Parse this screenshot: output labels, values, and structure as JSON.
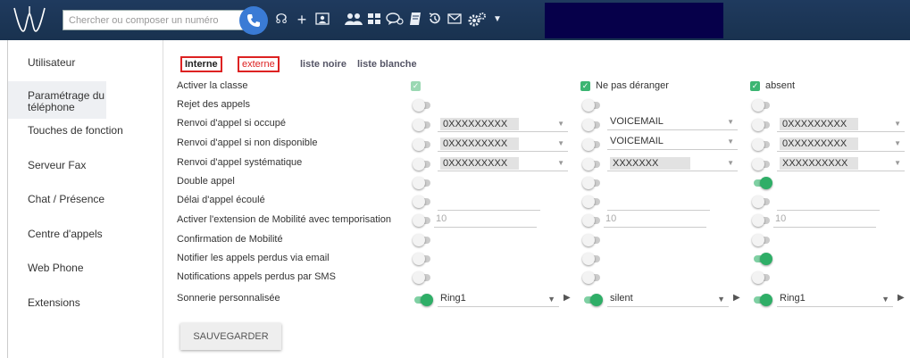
{
  "topbar": {
    "search_placeholder": "Chercher ou composer un numéro"
  },
  "sidebar": {
    "items": [
      {
        "label": "Utilisateur"
      },
      {
        "label": "Paramétrage du téléphone"
      },
      {
        "label": "Touches de fonction"
      },
      {
        "label": "Serveur Fax"
      },
      {
        "label": "Chat / Présence"
      },
      {
        "label": "Centre d'appels"
      },
      {
        "label": "Web Phone"
      },
      {
        "label": "Extensions"
      }
    ]
  },
  "tabs": {
    "interne": "Interne",
    "externe": "externe",
    "liste_noire": "liste noire",
    "liste_blanche": "liste blanche"
  },
  "columns": {
    "col1": {
      "checked": true
    },
    "col2": {
      "label": "Ne pas déranger",
      "checked": true
    },
    "col3": {
      "label": "absent",
      "checked": true
    }
  },
  "rows": [
    {
      "label": "Activer la classe"
    },
    {
      "label": "Rejet des appels"
    },
    {
      "label": "Renvoi d'appel si occupé"
    },
    {
      "label": "Renvoi d'appel si non disponible"
    },
    {
      "label": "Renvoi d'appel systématique"
    },
    {
      "label": "Double appel"
    },
    {
      "label": "Délai d'appel écoulé"
    },
    {
      "label": "Activer l'extension de Mobilité avec temporisation"
    },
    {
      "label": "Confirmation de Mobilité"
    },
    {
      "label": "Notifier les appels perdus via email"
    },
    {
      "label": "Notifications appels perdus par SMS"
    },
    {
      "label": "Sonnerie personnalisée"
    }
  ],
  "values": {
    "busy": [
      "0XXXXXXXXX",
      "VOICEMAIL",
      "0XXXXXXXXX"
    ],
    "unavailable": [
      "0XXXXXXXXX",
      "VOICEMAIL",
      "0XXXXXXXXX"
    ],
    "systematic": [
      "0XXXXXXXXX",
      "XXXXXXX",
      "XXXXXXXXXX"
    ],
    "mobility_timeout": [
      "10",
      "10",
      "10"
    ],
    "ringtone": [
      "Ring1",
      "silent",
      "Ring1"
    ]
  },
  "toggles": {
    "double_appel": [
      false,
      false,
      true
    ],
    "notify_email": [
      false,
      false,
      true
    ],
    "ringtone": [
      true,
      true,
      true
    ]
  },
  "save_label": "SAUVEGARDER",
  "colors": {
    "topbar": "#1f3a5e",
    "accent_green": "#2fae67",
    "tab_red": "#dd2222",
    "call_blue": "#3a7bd5"
  }
}
